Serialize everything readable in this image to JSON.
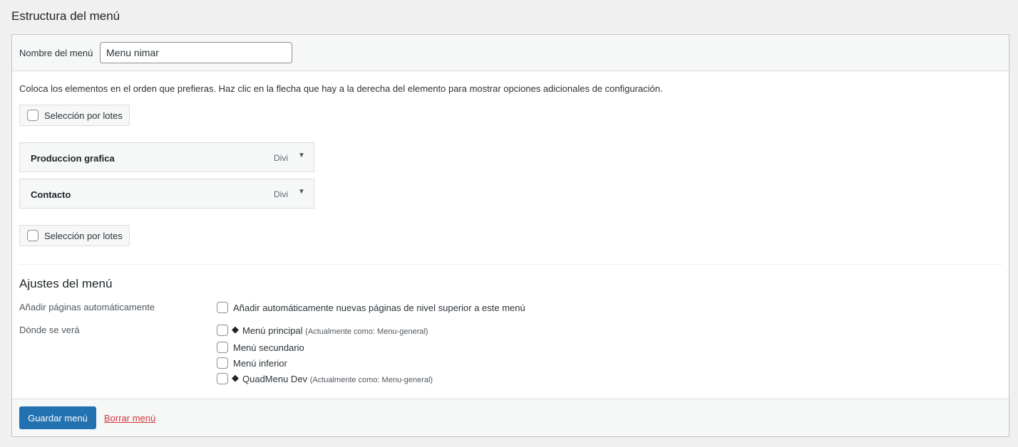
{
  "page": {
    "title": "Estructura del menú"
  },
  "menu_name": {
    "label": "Nombre del menú",
    "value": "Menu nimar"
  },
  "instructions": "Coloca los elementos en el orden que prefieras. Haz clic en la flecha que hay a la derecha del elemento para mostrar opciones adicionales de configuración.",
  "bulk_select": {
    "label": "Selección por lotes"
  },
  "menu_items": [
    {
      "title": "Produccion grafica",
      "type": "Divi",
      "arrow_icon": "triangle-down-icon"
    },
    {
      "title": "Contacto",
      "type": "Divi",
      "arrow_icon": "triangle-down-icon"
    }
  ],
  "settings": {
    "title": "Ajustes del menú",
    "auto_add": {
      "label": "Añadir páginas automáticamente",
      "option": "Añadir automáticamente nuevas páginas de nivel superior a este menú"
    },
    "locations": {
      "label": "Dónde se verá",
      "options": [
        {
          "name": "Menú principal",
          "note": "(Actualmente como: Menu-general)",
          "icon": "diamond-icon"
        },
        {
          "name": "Menú secundario",
          "note": ""
        },
        {
          "name": "Menú inferior",
          "note": ""
        },
        {
          "name": "QuadMenu Dev",
          "note": "(Actualmente como: Menu-general)",
          "icon": "diamond-icon"
        }
      ]
    }
  },
  "footer": {
    "save_label": "Guardar menú",
    "delete_label": "Borrar menú"
  },
  "colors": {
    "primary": "#2271b1",
    "danger": "#d63638",
    "background": "#f0f0f1"
  }
}
